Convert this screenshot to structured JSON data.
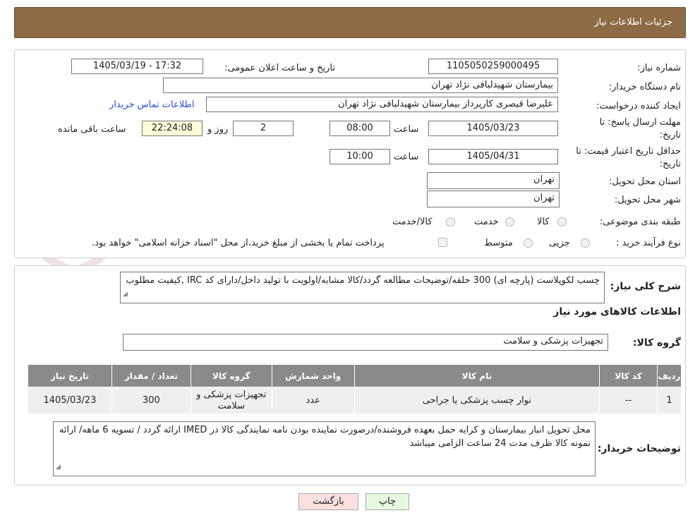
{
  "header": {
    "title": "جزئیات اطلاعات نیاز"
  },
  "watermark": {
    "text": "AriaTender.neT"
  },
  "form": {
    "need_number_label": "شماره نیاز:",
    "need_number": "1105050259000495",
    "announce_label": "تاریخ و ساعت اعلان عمومی:",
    "announce_value": "1405/03/19 - 17:32",
    "buyer_org_label": "نام دستگاه خریدار:",
    "buyer_org": "بیمارستان شهیدلبافی نژاد تهران",
    "creator_label": "ایجاد کننده درخواست:",
    "creator": "علیرضا قیصری کارپرداز بیمارستان شهیدلبافی نژاد تهران",
    "contact_link": "اطلاعات تماس خریدار",
    "deadline_label": "مهلت ارسال پاسخ: تا تاریخ:",
    "deadline_date": "1405/03/23",
    "time_label": "ساعت",
    "deadline_time": "08:00",
    "days_value": "2",
    "days_label": "روز و",
    "remaining_time": "22:24:08",
    "remaining_label": "ساعت باقی مانده",
    "validity_label": "حداقل تاریخ اعتبار قیمت: تا تاریخ:",
    "validity_date": "1405/04/31",
    "validity_time": "10:00",
    "province_label": "استان محل تحویل:",
    "province": "تهران",
    "city_label": "شهر محل تحویل:",
    "city": "تهران",
    "category_label": "طبقه بندی موضوعی:",
    "category_options": [
      "کالا",
      "خدمت",
      "کالا/خدمت"
    ],
    "process_label": "نوع فرآیند خرید :",
    "process_options": [
      "جزیی",
      "متوسط"
    ],
    "payment_note": "پرداخت تمام یا بخشی از مبلغ خرید،از محل \"اسناد خزانه اسلامی\" خواهد بود."
  },
  "details": {
    "summary_label": "شرح کلی نیاز:",
    "summary_text": "چسب لکوپلاست (پارچه ای)  300 حلقه/توضیحات مطالعه گردد/کالا مشابه/اولویت با تولید داخل/دارای کد IRC ,کیفیت مطلوب",
    "goods_info_title": "اطلاعات کالاهای مورد نیاز",
    "goods_group_label": "گروه کالا:",
    "goods_group": "تجهیزات پزشکی و سلامت",
    "table": {
      "headers": [
        "ردیف",
        "کد کالا",
        "نام کالا",
        "واحد شمارش",
        "گروه کالا",
        "تعداد / مقدار",
        "تاریخ نیاز"
      ],
      "rows": [
        [
          "1",
          "--",
          "نوار چسب پزشکی یا جراحی",
          "عدد",
          "تجهیزات پزشکی و سلامت",
          "300",
          "1405/03/23"
        ]
      ]
    },
    "buyer_notes_label": "توضیحات خریدار:",
    "buyer_notes": "محل تحویل انبار بیمارستان و کرایه حمل بعهده فروشنده/درصورت نماینده بودن نامه نمایندگی کالا در  IMED ارائه گردد / تسویه 6 ماهه/ ارائه نمونه کالا ظرف مدت 24 ساعت الزامی میباشد"
  },
  "buttons": {
    "print": "چاپ",
    "back": "بازگشت"
  }
}
